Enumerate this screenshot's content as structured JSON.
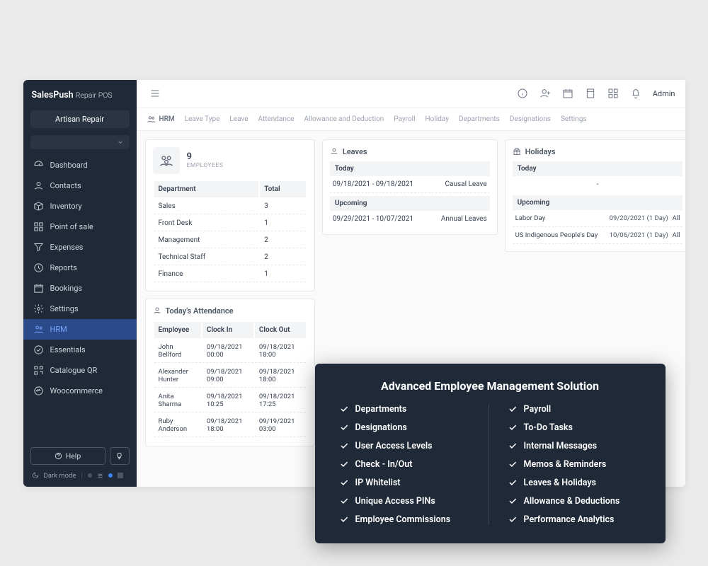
{
  "brand": {
    "name": "SalesPush",
    "sub": "Repair POS"
  },
  "tenant": "Artisan Repair",
  "nav": [
    {
      "label": "Dashboard"
    },
    {
      "label": "Contacts"
    },
    {
      "label": "Inventory"
    },
    {
      "label": "Point of sale"
    },
    {
      "label": "Expenses"
    },
    {
      "label": "Reports"
    },
    {
      "label": "Bookings"
    },
    {
      "label": "Settings"
    },
    {
      "label": "HRM"
    },
    {
      "label": "Essentials"
    },
    {
      "label": "Catalogue QR"
    },
    {
      "label": "Woocommerce"
    }
  ],
  "help": "Help",
  "dark": "Dark mode",
  "admin": "Admin",
  "tabs": {
    "bc": "HRM",
    "items": [
      "Leave Type",
      "Leave",
      "Attendance",
      "Allowance and Deduction",
      "Payroll",
      "Holiday",
      "Departments",
      "Designations",
      "Settings"
    ]
  },
  "employees": {
    "count": "9",
    "label": "EMPLOYEES",
    "deptHdr": "Department",
    "totHdr": "Total",
    "rows": [
      [
        "Sales",
        "3"
      ],
      [
        "Front Desk",
        "1"
      ],
      [
        "Management",
        "2"
      ],
      [
        "Technical Staff",
        "2"
      ],
      [
        "Finance",
        "1"
      ]
    ]
  },
  "attendance": {
    "title": "Today's Attendance",
    "hdrs": [
      "Employee",
      "Clock In",
      "Clock Out"
    ],
    "rows": [
      [
        "John Bellford",
        "09/18/2021 00:00",
        "09/18/2021 18:00"
      ],
      [
        "Alexander Hunter",
        "09/18/2021 09:00",
        "09/18/2021 18:00"
      ],
      [
        "Anita Sharma",
        "09/18/2021 10:25",
        "09/18/2021 17:25"
      ],
      [
        "Ruby Anderson",
        "09/18/2021 18:00",
        "09/19/2021 03:00"
      ]
    ]
  },
  "leaves": {
    "title": "Leaves",
    "today": "Today",
    "upcoming": "Upcoming",
    "todayRow": [
      "09/18/2021 - 09/18/2021",
      "Causal Leave"
    ],
    "upRow": [
      "09/29/2021 - 10/07/2021",
      "Annual Leaves"
    ]
  },
  "holidays": {
    "title": "Holidays",
    "today": "Today",
    "todayVal": "-",
    "upcoming": "Upcoming",
    "rows": [
      [
        "Labor Day",
        "09/20/2021 (1 Day)",
        "All"
      ],
      [
        "US Indigenous People's Day",
        "10/06/2021 (1 Day)",
        "All"
      ]
    ]
  },
  "overlay": {
    "title": "Advanced Employee Management Solution",
    "left": [
      "Departments",
      "Designations",
      "User Access Levels",
      "Check - In/Out",
      "IP Whitelist",
      "Unique Access PINs",
      "Employee Commissions"
    ],
    "right": [
      "Payroll",
      "To-Do Tasks",
      "Internal Messages",
      "Memos & Reminders",
      "Leaves & Holidays",
      "Allowance & Deductions",
      "Performance Analytics"
    ]
  }
}
